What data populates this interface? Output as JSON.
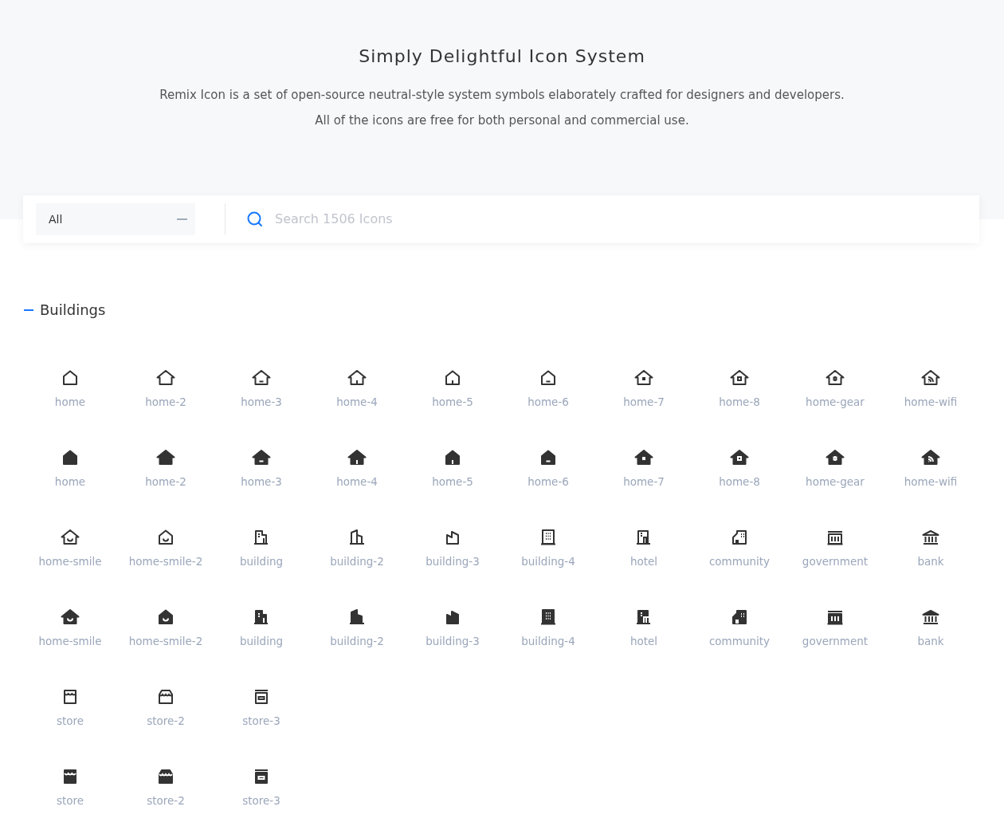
{
  "hero": {
    "title": "Simply Delightful Icon System",
    "description": [
      "Remix Icon is a set of open-source neutral-style system symbols elaborately crafted for designers and developers.",
      "All of the icons are free for both personal and commercial use."
    ]
  },
  "search_bar": {
    "category": "All",
    "placeholder": "Search 1506 Icons"
  },
  "section": {
    "title": "Buildings"
  },
  "icon_rows": [
    [
      {
        "label": "home",
        "kind": "plain",
        "filled": false
      },
      {
        "label": "home-2",
        "kind": "eaves",
        "filled": false
      },
      {
        "label": "home-3",
        "kind": "eavesbar",
        "filled": false
      },
      {
        "label": "home-4",
        "kind": "eavesdoor",
        "filled": false
      },
      {
        "label": "home-5",
        "kind": "door",
        "filled": false
      },
      {
        "label": "home-6",
        "kind": "bar",
        "filled": false
      },
      {
        "label": "home-7",
        "kind": "eavesdot",
        "filled": false
      },
      {
        "label": "home-8",
        "kind": "eavessquare",
        "filled": false
      },
      {
        "label": "home-gear",
        "kind": "eavesgear",
        "filled": false
      },
      {
        "label": "home-wifi",
        "kind": "eaveswifi",
        "filled": false
      }
    ],
    [
      {
        "label": "home",
        "kind": "plain",
        "filled": true
      },
      {
        "label": "home-2",
        "kind": "eaves",
        "filled": true
      },
      {
        "label": "home-3",
        "kind": "eavesbar",
        "filled": true
      },
      {
        "label": "home-4",
        "kind": "eavesdoor",
        "filled": true
      },
      {
        "label": "home-5",
        "kind": "door",
        "filled": true
      },
      {
        "label": "home-6",
        "kind": "bar",
        "filled": true
      },
      {
        "label": "home-7",
        "kind": "eavesdot",
        "filled": true
      },
      {
        "label": "home-8",
        "kind": "eavessquare",
        "filled": true
      },
      {
        "label": "home-gear",
        "kind": "eavesgear",
        "filled": true
      },
      {
        "label": "home-wifi",
        "kind": "eaveswifi",
        "filled": true
      }
    ],
    [
      {
        "label": "home-smile",
        "kind": "eavessmile",
        "filled": false
      },
      {
        "label": "home-smile-2",
        "kind": "smile",
        "filled": false
      },
      {
        "label": "building",
        "kind": "building",
        "filled": false
      },
      {
        "label": "building-2",
        "kind": "building2",
        "filled": false
      },
      {
        "label": "building-3",
        "kind": "building3",
        "filled": false
      },
      {
        "label": "building-4",
        "kind": "building4",
        "filled": false
      },
      {
        "label": "hotel",
        "kind": "hotel",
        "filled": false
      },
      {
        "label": "community",
        "kind": "community",
        "filled": false
      },
      {
        "label": "government",
        "kind": "government",
        "filled": false
      },
      {
        "label": "bank",
        "kind": "bank",
        "filled": false
      }
    ],
    [
      {
        "label": "home-smile",
        "kind": "eavessmile",
        "filled": true
      },
      {
        "label": "home-smile-2",
        "kind": "smile",
        "filled": true
      },
      {
        "label": "building",
        "kind": "building",
        "filled": true
      },
      {
        "label": "building-2",
        "kind": "building2",
        "filled": true
      },
      {
        "label": "building-3",
        "kind": "building3",
        "filled": true
      },
      {
        "label": "building-4",
        "kind": "building4",
        "filled": true
      },
      {
        "label": "hotel",
        "kind": "hotel",
        "filled": true
      },
      {
        "label": "community",
        "kind": "community",
        "filled": true
      },
      {
        "label": "government",
        "kind": "government",
        "filled": true
      },
      {
        "label": "bank",
        "kind": "bank",
        "filled": true
      }
    ],
    [
      {
        "label": "store",
        "kind": "store",
        "filled": false
      },
      {
        "label": "store-2",
        "kind": "store2",
        "filled": false
      },
      {
        "label": "store-3",
        "kind": "store3",
        "filled": false
      }
    ],
    [
      {
        "label": "store",
        "kind": "store",
        "filled": true
      },
      {
        "label": "store-2",
        "kind": "store2",
        "filled": true
      },
      {
        "label": "store-3",
        "kind": "store3",
        "filled": true
      }
    ]
  ]
}
